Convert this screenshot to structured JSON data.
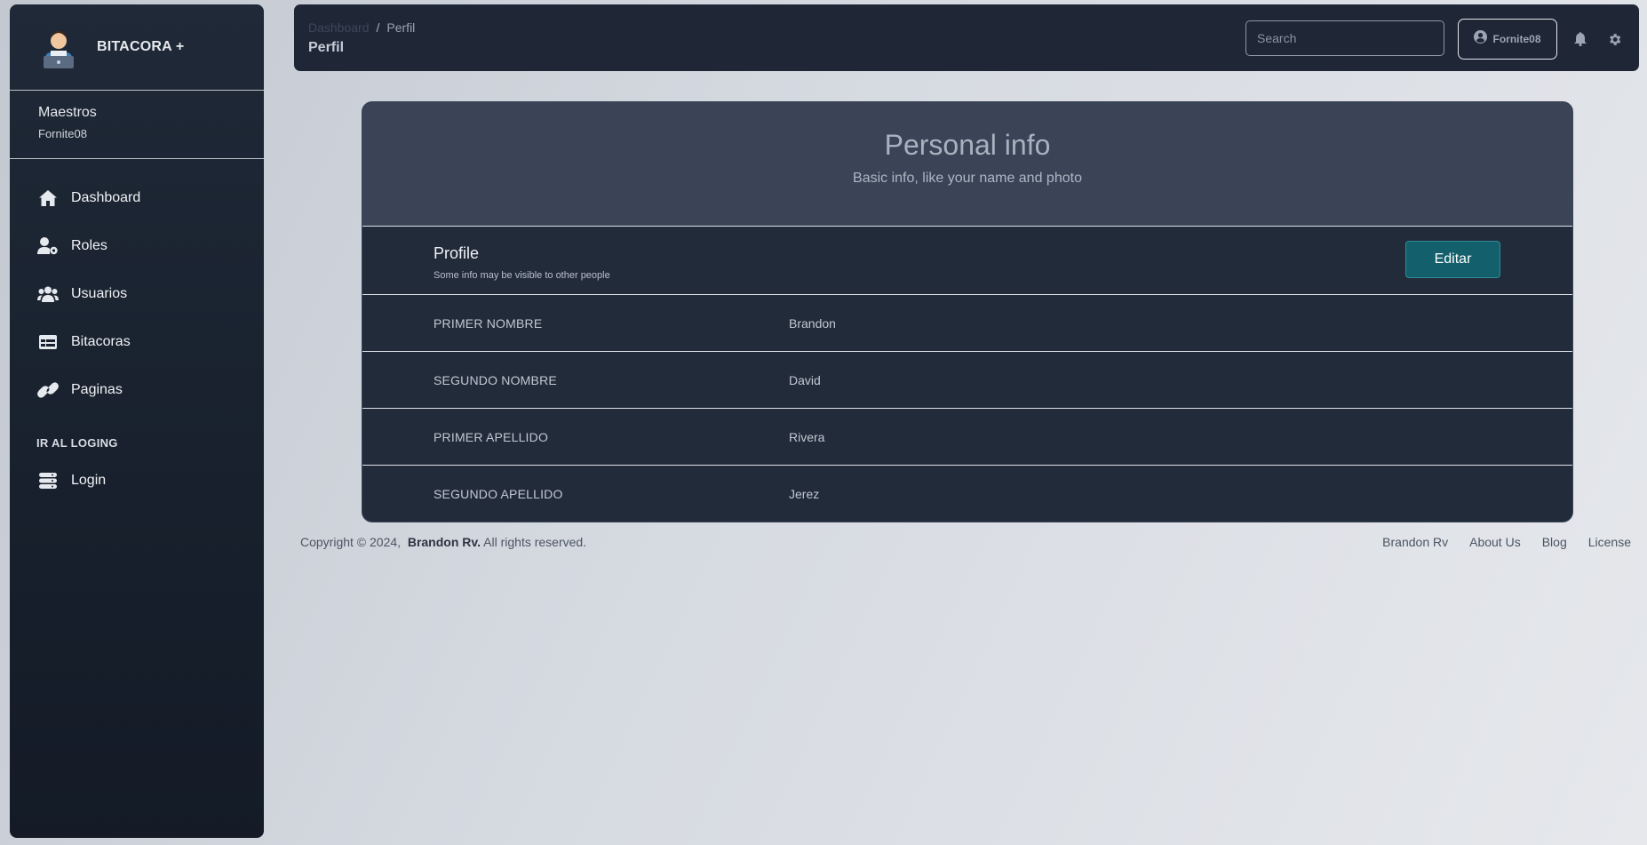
{
  "sidebar": {
    "brand": "BITACORA +",
    "user": {
      "role": "Maestros",
      "username": "Fornite08"
    },
    "nav": [
      {
        "label": "Dashboard",
        "icon": "home-icon"
      },
      {
        "label": "Roles",
        "icon": "user-gear-icon"
      },
      {
        "label": "Usuarios",
        "icon": "users-icon"
      },
      {
        "label": "Bitacoras",
        "icon": "table-icon"
      },
      {
        "label": "Paginas",
        "icon": "link-icon"
      }
    ],
    "section_label": "IR AL LOGING",
    "login": {
      "label": "Login",
      "icon": "database-icon"
    }
  },
  "topbar": {
    "breadcrumb": {
      "root": "Dashboard",
      "separator": "/",
      "current": "Perfil"
    },
    "title": "Perfil",
    "search_placeholder": "Search",
    "user_button": "Fornite08"
  },
  "card": {
    "title": "Personal info",
    "subtitle": "Basic info, like your name and photo",
    "profile_title": "Profile",
    "profile_subtitle": "Some info may be visible to other people",
    "edit_label": "Editar",
    "fields": [
      {
        "label": "PRIMER NOMBRE",
        "value": "Brandon"
      },
      {
        "label": "SEGUNDO NOMBRE",
        "value": "David"
      },
      {
        "label": "PRIMER APELLIDO",
        "value": "Rivera"
      },
      {
        "label": "SEGUNDO APELLIDO",
        "value": "Jerez"
      }
    ]
  },
  "footer": {
    "copyright_prefix": "Copyright © 2024,",
    "author": "Brandon Rv.",
    "rights": "All rights reserved.",
    "links": [
      "Brandon Rv",
      "About Us",
      "Blog",
      "License"
    ]
  },
  "colors": {
    "sidebar_bg": "#1f2937",
    "topbar_bg": "#1f2737",
    "card_header_bg": "#3a4456",
    "edit_button": "#135f6b"
  }
}
